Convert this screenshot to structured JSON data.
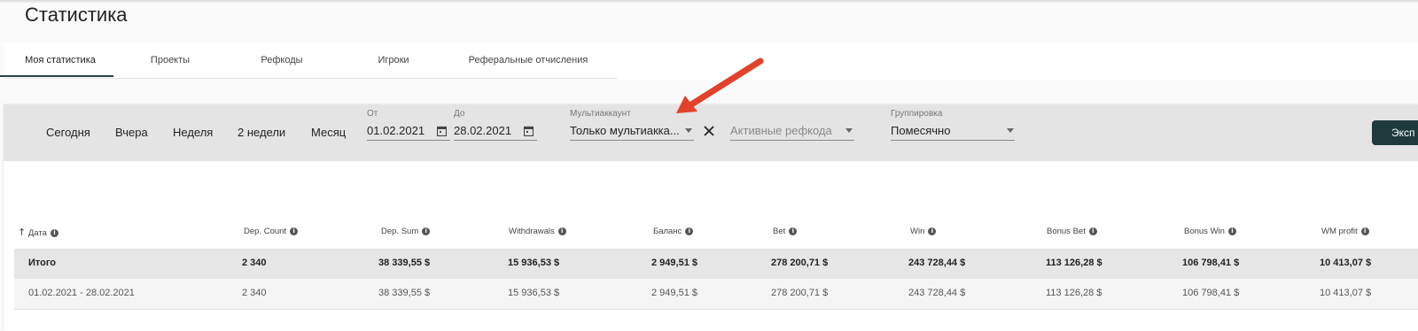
{
  "page_title": "Статистика",
  "tabs": [
    "Моя статистика",
    "Проекты",
    "Рефкоды",
    "Игроки",
    "Реферальные отчисления"
  ],
  "quick_ranges": [
    "Сегодня",
    "Вчера",
    "Неделя",
    "2 недели",
    "Месяц"
  ],
  "filters": {
    "from_label": "От",
    "from_value": "01.02.2021",
    "to_label": "До",
    "to_value": "28.02.2021",
    "multi_label": "Мультиаккаунт",
    "multi_value": "Только мультиакка...",
    "refcodes_placeholder": "Активные рефкода",
    "grouping_label": "Группировка",
    "grouping_value": "Помесячно",
    "export_label": "Эксп"
  },
  "table": {
    "headers": [
      "Дата",
      "Dep. Count",
      "Dep. Sum",
      "Withdrawals",
      "Баланс",
      "Bet",
      "Win",
      "Bonus Bet",
      "Bonus Win",
      "WM profit"
    ],
    "total_row": [
      "Итого",
      "2 340",
      "38 339,55 $",
      "15 936,53 $",
      "2 949,51 $",
      "278 200,71 $",
      "243 728,44 $",
      "113 126,28 $",
      "106 798,41 $",
      "10 413,07 $"
    ],
    "data_row": [
      "01.02.2021 - 28.02.2021",
      "2 340",
      "38 339,55 $",
      "15 936,53 $",
      "2 949,51 $",
      "278 200,71 $",
      "243 728,44 $",
      "113 126,28 $",
      "106 798,41 $",
      "10 413,07 $"
    ]
  },
  "colors": {
    "accent": "#1f3a3b",
    "annotation_arrow": "#e3412b"
  }
}
